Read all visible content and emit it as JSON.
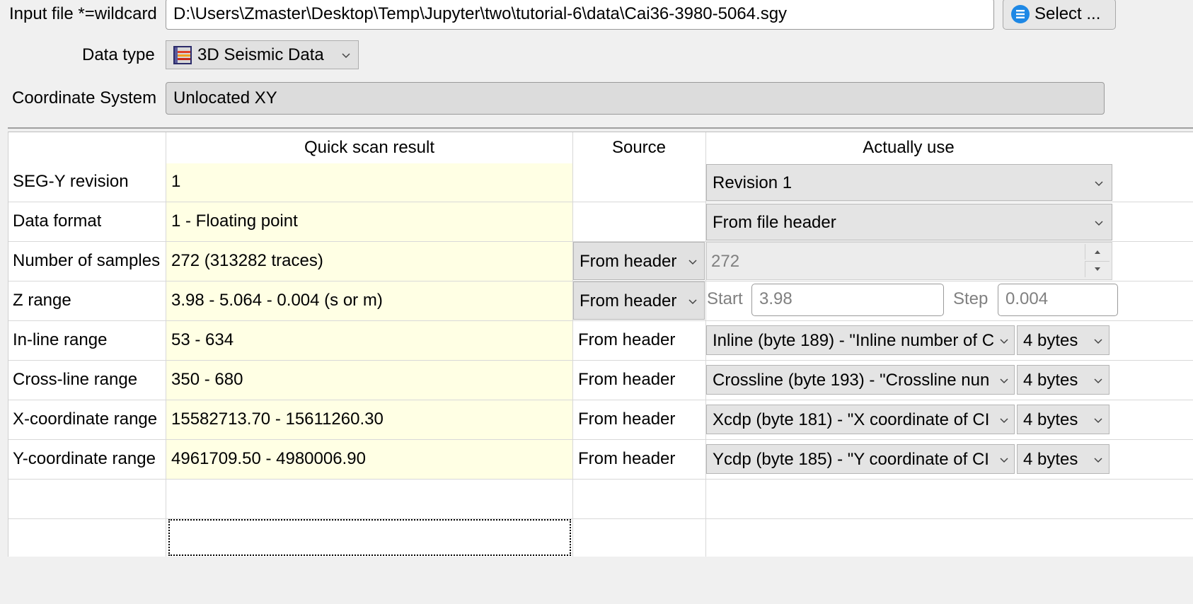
{
  "header": {
    "input_file_label": "Input file *=wildcard",
    "input_file_value": "D:\\Users\\Zmaster\\Desktop\\Temp\\Jupyter\\two\\tutorial-6\\data\\Cai36-3980-5064.sgy",
    "select_button": "Select ...",
    "data_type_label": "Data type",
    "data_type_value": "3D Seismic Data",
    "coord_label": "Coordinate System",
    "coord_value": "Unlocated XY"
  },
  "table": {
    "columns": {
      "quick_scan": "Quick scan result",
      "source": "Source",
      "actually_use": "Actually use"
    },
    "rows": [
      {
        "label": "SEG-Y revision",
        "scan": "1",
        "use": "Revision 1"
      },
      {
        "label": "Data format",
        "scan": "1 - Floating point",
        "use": "From file header"
      },
      {
        "label": "Number of samples",
        "scan": "272 (313282 traces)",
        "source": "From header",
        "use": "272"
      },
      {
        "label": "Z range",
        "scan": "3.98 - 5.064 - 0.004 (s or m)",
        "source": "From header",
        "start_label": "Start",
        "start_value": "3.98",
        "step_label": "Step",
        "step_value": "0.004"
      },
      {
        "label": "In-line range",
        "scan": "53 - 634",
        "source": "From header",
        "use": "Inline (byte 189) - \"Inline number of C",
        "bytes": "4 bytes"
      },
      {
        "label": "Cross-line range",
        "scan": "350 - 680",
        "source": "From header",
        "use": "Crossline (byte 193) - \"Crossline nun",
        "bytes": "4 bytes"
      },
      {
        "label": "X-coordinate range",
        "scan": "15582713.70 - 15611260.30",
        "source": "From header",
        "use": "Xcdp (byte 181) - \"X coordinate of CI",
        "bytes": "4 bytes"
      },
      {
        "label": "Y-coordinate range",
        "scan": "4961709.50 - 4980006.90",
        "source": "From header",
        "use": "Ycdp (byte 185) - \"Y coordinate of CI",
        "bytes": "4 bytes"
      }
    ]
  },
  "icons": {
    "select": "list-icon",
    "data_type": "seismic-cube-icon",
    "combo": "chevron-down-icon",
    "spin_up": "spin-up-icon",
    "spin_down": "spin-down-icon"
  },
  "colors": {
    "scan_background": "#ffffe4",
    "select_icon": "#1e88e5"
  }
}
